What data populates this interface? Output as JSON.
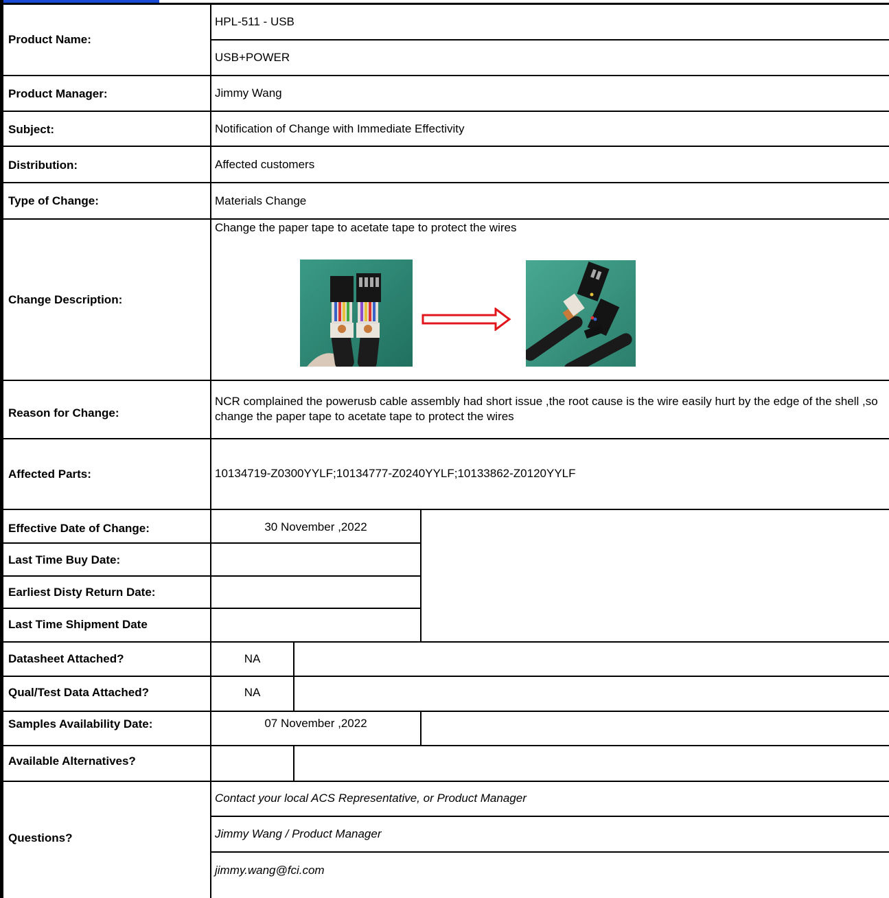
{
  "labels": {
    "product_name": "Product Name:",
    "product_manager": "Product Manager:",
    "subject": "Subject:",
    "distribution": "Distribution:",
    "type_of_change": "Type of Change:",
    "change_description": "Change Description:",
    "reason_for_change": "Reason for Change:",
    "affected_parts": "Affected Parts:",
    "effective_date": "Effective Date of Change:",
    "last_time_buy": "Last Time Buy Date:",
    "earliest_disty_return": "Earliest Disty Return Date:",
    "last_time_shipment": "Last Time Shipment Date",
    "datasheet_attached": "Datasheet Attached?",
    "qual_test_data": "Qual/Test Data Attached?",
    "samples_availability": "Samples Availability Date:",
    "available_alternatives": "Available Alternatives?",
    "questions": "Questions?"
  },
  "values": {
    "product_name_1": "HPL-511 - USB",
    "product_name_2": "USB+POWER",
    "product_manager": "Jimmy Wang",
    "subject": "Notification of Change with Immediate Effectivity",
    "distribution": "Affected customers",
    "type_of_change": "Materials Change",
    "change_description": "Change the paper tape to acetate tape to protect the wires",
    "reason_for_change": "NCR complained the powerusb cable assembly had short issue ,the root cause is the wire easily hurt by the edge of the shell ,so change the paper tape to acetate tape to protect the wires",
    "affected_parts": "10134719-Z0300YYLF;10134777-Z0240YYLF;10133862-Z0120YYLF",
    "effective_date": "30 November ,2022",
    "last_time_buy": "",
    "earliest_disty_return": "",
    "last_time_shipment": "",
    "datasheet_attached": "NA",
    "qual_test_data": "NA",
    "samples_availability": "07 November ,2022",
    "available_alternatives": "",
    "questions_1": "Contact your local ACS Representative, or Product Manager",
    "questions_2": "Jimmy Wang / Product Manager",
    "questions_3": "jimmy.wang@fci.com"
  },
  "colors": {
    "arrow": "#e0161c",
    "photo_background": "#2f8a78",
    "link_bar": "#1a4bd6"
  }
}
